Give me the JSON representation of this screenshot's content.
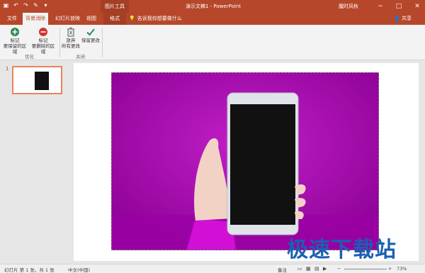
{
  "titlebar": {
    "context_tools": "图片工具",
    "doc_title": "演示文稿1 - PowerPoint",
    "user": "魔时风秋",
    "window_buttons": [
      "−",
      "□",
      "✕"
    ]
  },
  "tabs": [
    {
      "label": "文件",
      "active": false
    },
    {
      "label": "背景消除",
      "active": true
    },
    {
      "label": "幻灯片放映",
      "active": false
    },
    {
      "label": "视图",
      "active": false
    },
    {
      "label": "格式",
      "active": false
    }
  ],
  "tellme": "告诉我你想要做什么",
  "share": "共享",
  "ribbon": {
    "buttons": [
      {
        "label1": "标记",
        "label2": "要保留的区域",
        "icon": "plus-circle-icon"
      },
      {
        "label1": "标记",
        "label2": "要删除的区域",
        "icon": "minus-circle-icon"
      },
      {
        "label1": "放弃",
        "label2": "所有更改",
        "icon": "discard-icon"
      },
      {
        "label1": "保留更改",
        "label2": "",
        "icon": "checkmark-icon"
      }
    ],
    "groups": [
      "优化",
      "关闭"
    ]
  },
  "slides": [
    {
      "number": "1"
    }
  ],
  "statusbar": {
    "slide_info": "幻灯片 第 1 张，共 1 张",
    "language": "中文(中国)",
    "notes": "备注",
    "zoom": "73%"
  },
  "watermark": "极速下载站",
  "colors": {
    "accent": "#b7472a",
    "background_removed": "#b000b8"
  }
}
